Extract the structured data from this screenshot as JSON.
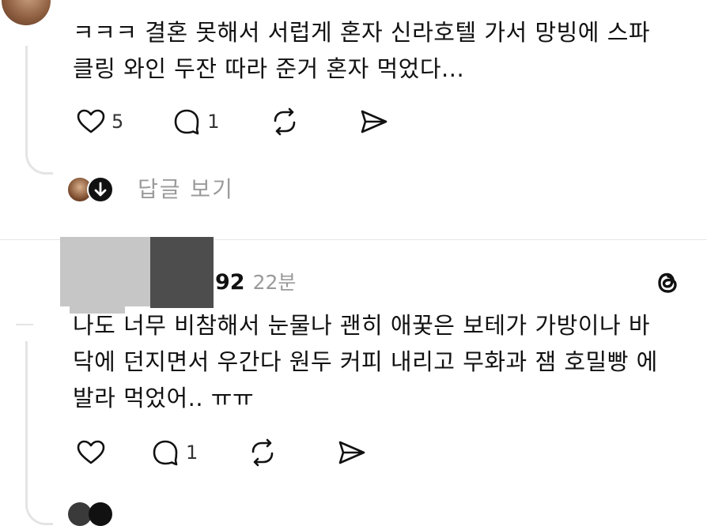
{
  "post1": {
    "text_line1": "ㅋㅋㅋ 결혼 못해서 서럽게 혼자 신라호텔 가서 망빙에 스파",
    "text_line2": "클링 와인 두잔 따라 준거 혼자 먹었다...",
    "like_count": "5",
    "reply_count": "1",
    "view_replies": "답글 보기"
  },
  "post2": {
    "username": "92",
    "time": "22분",
    "text_line1": "나도 너무 비참해서 눈물나 괜히 애꿎은 보테가 가방이나 바",
    "text_line2": "닥에 던지면서 우간다 원두 커피 내리고 무화과 잼 호밀빵 에",
    "text_line3": "발라 먹었어.. ㅠㅠ",
    "reply_count": "1"
  },
  "colors": {
    "thread_line": "#e4e4e4",
    "muted_text": "#9b9b9b",
    "redaction_light": "#c6c6c6",
    "redaction_dark": "#4d4d4d"
  }
}
